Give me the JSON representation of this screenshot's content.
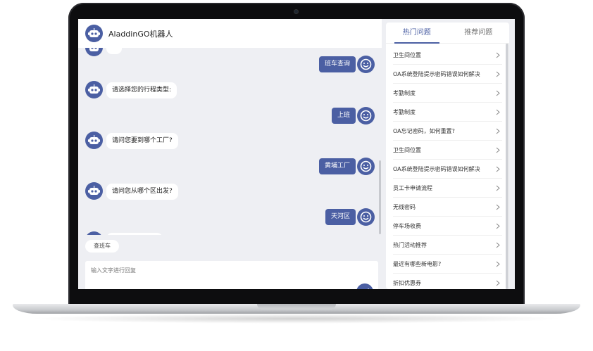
{
  "window": {
    "title": "AladdinGO机器人"
  },
  "colors": {
    "accent": "#4b5fa3",
    "chat_background": "#eeeff3",
    "bubble_bot": "#ffffff"
  },
  "icons": {
    "bot_avatar": "robot-icon",
    "user_avatar": "smiley-icon",
    "send": "send-icon",
    "list_arrow": "chevron-right-icon"
  },
  "messages": [
    {
      "from": "user",
      "text": "班车查询"
    },
    {
      "from": "bot",
      "text": "请选择您的行程类型:"
    },
    {
      "from": "user",
      "text": "上班"
    },
    {
      "from": "bot",
      "text": "请问您要到哪个工厂?"
    },
    {
      "from": "user",
      "text": "黄埔工厂"
    },
    {
      "from": "bot",
      "text": "请问您从哪个区出发?"
    },
    {
      "from": "user",
      "text": "天河区"
    }
  ],
  "quick_reply": {
    "label": "查班车"
  },
  "input": {
    "placeholder": "输入文字进行回复"
  },
  "side_panel": {
    "tabs": [
      {
        "label": "热门问题",
        "active": true
      },
      {
        "label": "推荐问题",
        "active": false
      }
    ],
    "questions": [
      "卫生间位置",
      "OA系统登陆提示密码错误如何解决",
      "考勤制度",
      "考勤制度",
      "OA忘记密码，如何重置?",
      "卫生间位置",
      "OA系统登陆提示密码错误如何解决",
      "员工卡申请流程",
      "无线密码",
      "停车场收费",
      "热门活动推荐",
      "最近有哪些新电影?",
      "折扣优惠券"
    ]
  }
}
